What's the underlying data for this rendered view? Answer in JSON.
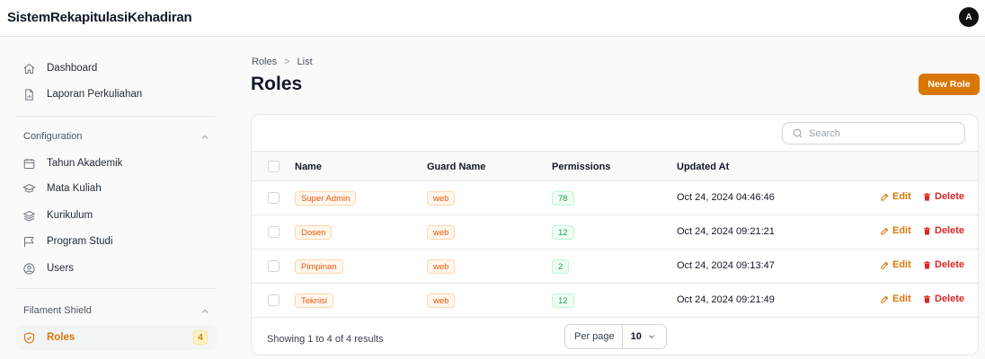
{
  "app": {
    "title": "SistemRekapitulasiKehadiran",
    "avatar_initial": "A"
  },
  "colors": {
    "accent": "#d97706",
    "danger": "#dc2626",
    "success": "#16a34a"
  },
  "sidebar": {
    "top_items": [
      {
        "label": "Dashboard",
        "icon": "home-icon"
      },
      {
        "label": "Laporan Perkuliahan",
        "icon": "document-chart-icon"
      }
    ],
    "groups": [
      {
        "label": "Configuration",
        "items": [
          {
            "label": "Tahun Akademik",
            "icon": "calendar-icon"
          },
          {
            "label": "Mata Kuliah",
            "icon": "academic-cap-icon"
          },
          {
            "label": "Kurikulum",
            "icon": "stack-icon"
          },
          {
            "label": "Program Studi",
            "icon": "flag-icon"
          },
          {
            "label": "Users",
            "icon": "user-circle-icon"
          }
        ]
      },
      {
        "label": "Filament Shield",
        "items": [
          {
            "label": "Roles",
            "icon": "shield-check-icon",
            "badge": "4",
            "active": true
          }
        ]
      }
    ]
  },
  "breadcrumb": {
    "root": "Roles",
    "separator": ">",
    "current": "List"
  },
  "page": {
    "title": "Roles",
    "new_button": "New Role"
  },
  "table": {
    "search_placeholder": "Search",
    "columns": [
      "Name",
      "Guard Name",
      "Permissions",
      "Updated At"
    ],
    "rows": [
      {
        "name": "Super Admin",
        "guard": "web",
        "permissions": "78",
        "updated_at": "Oct 24, 2024 04:46:46"
      },
      {
        "name": "Dosen",
        "guard": "web",
        "permissions": "12",
        "updated_at": "Oct 24, 2024 09:21:21"
      },
      {
        "name": "Pimpinan",
        "guard": "web",
        "permissions": "2",
        "updated_at": "Oct 24, 2024 09:13:47"
      },
      {
        "name": "Teknisi",
        "guard": "web",
        "permissions": "12",
        "updated_at": "Oct 24, 2024 09:21:49"
      }
    ],
    "edit_label": "Edit",
    "delete_label": "Delete",
    "footer": {
      "summary": "Showing 1 to 4 of 4 results",
      "per_page_label": "Per page",
      "per_page_value": "10"
    }
  }
}
